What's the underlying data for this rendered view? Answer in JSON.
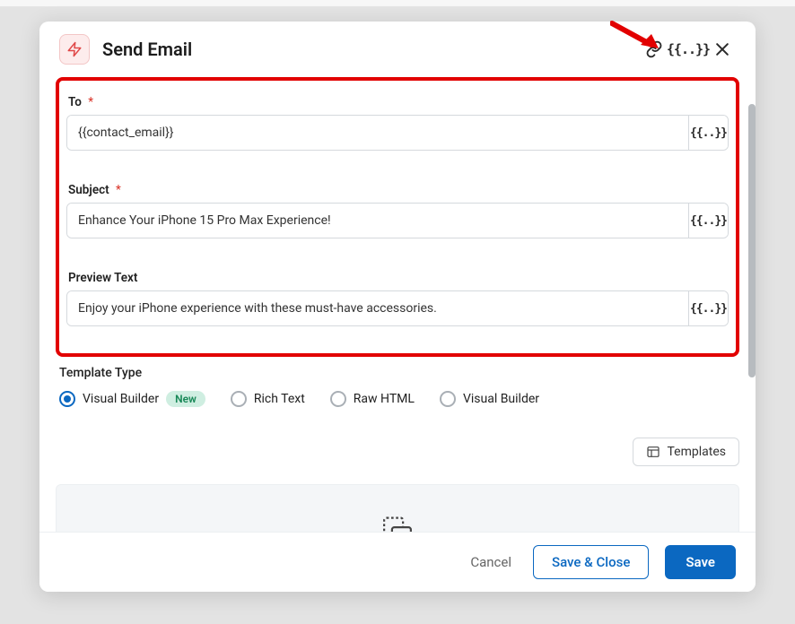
{
  "header": {
    "title": "Send Email"
  },
  "fields": {
    "to": {
      "label": "To",
      "required": true,
      "value": "{{contact_email}}"
    },
    "subject": {
      "label": "Subject",
      "required": true,
      "value": "Enhance Your iPhone 15 Pro Max Experience!"
    },
    "preview": {
      "label": "Preview Text",
      "required": false,
      "value": "Enjoy your iPhone experience with these must-have accessories."
    }
  },
  "templateType": {
    "label": "Template Type",
    "options": [
      {
        "label": "Visual Builder",
        "badge": "New",
        "selected": true
      },
      {
        "label": "Rich Text",
        "selected": false
      },
      {
        "label": "Raw HTML",
        "selected": false
      },
      {
        "label": "Visual Builder",
        "selected": false
      }
    ]
  },
  "templatesBtn": "Templates",
  "footer": {
    "cancel": "Cancel",
    "saveClose": "Save & Close",
    "save": "Save"
  },
  "curly": "{{..}}"
}
